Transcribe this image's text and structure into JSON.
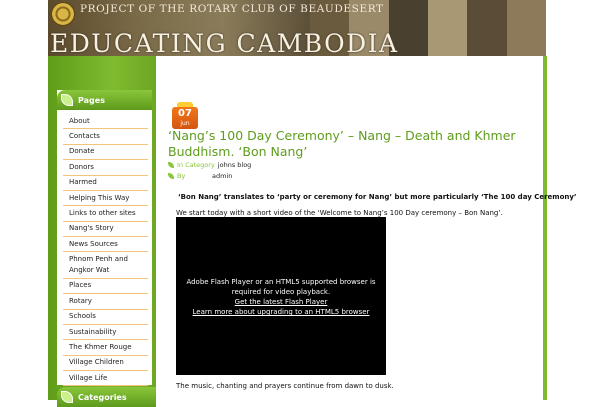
{
  "header": {
    "subtitle": "Project of the Rotary Club of Beaudesert",
    "title": "Educating Cambodia"
  },
  "sidebar": {
    "pages_heading": "Pages",
    "pages": [
      "About",
      "Contacts",
      "Donate",
      "Donors",
      "Harmed",
      "Helping This Way",
      "Links to other sites",
      "Nang's Story",
      "News Sources",
      "Phnom Penh and Angkor Wat",
      "Places",
      "Rotary",
      "Schools",
      "Sustainability",
      "The Khmer Rouge",
      "Village Children",
      "Village Life"
    ],
    "categories_heading": "Categories"
  },
  "post": {
    "date_day": "07",
    "date_month": "jun",
    "title": "‘Nang’s 100 Day Ceremony’ – Nang – Death and Khmer Buddhism. ‘Bon Nang’",
    "category_label": "In Category",
    "category_value": "johns blog",
    "by_label": "By",
    "by_value": "admin",
    "lead": "‘Bon Nang’ translates to ‘party or ceremony for Nang’ but more particularly ‘The 100 day Ceremony’",
    "intro": "We start today with a short video of the ‘Welcome to Nang’s 100 Day ceremony – Bon Nang’.",
    "video_message": "Adobe Flash Player or an HTML5 supported browser is required for video playback.",
    "video_link1": "Get the latest Flash Player",
    "video_link2": "Learn more about upgrading to an HTML5 browser",
    "after_video": "The music, chanting and prayers continue from dawn to dusk."
  },
  "colors": {
    "brand_green": "#7fbb2f",
    "title_green": "#5e9d1c",
    "list_divider": "#f4c47a",
    "date_badge": "#e8661a"
  }
}
